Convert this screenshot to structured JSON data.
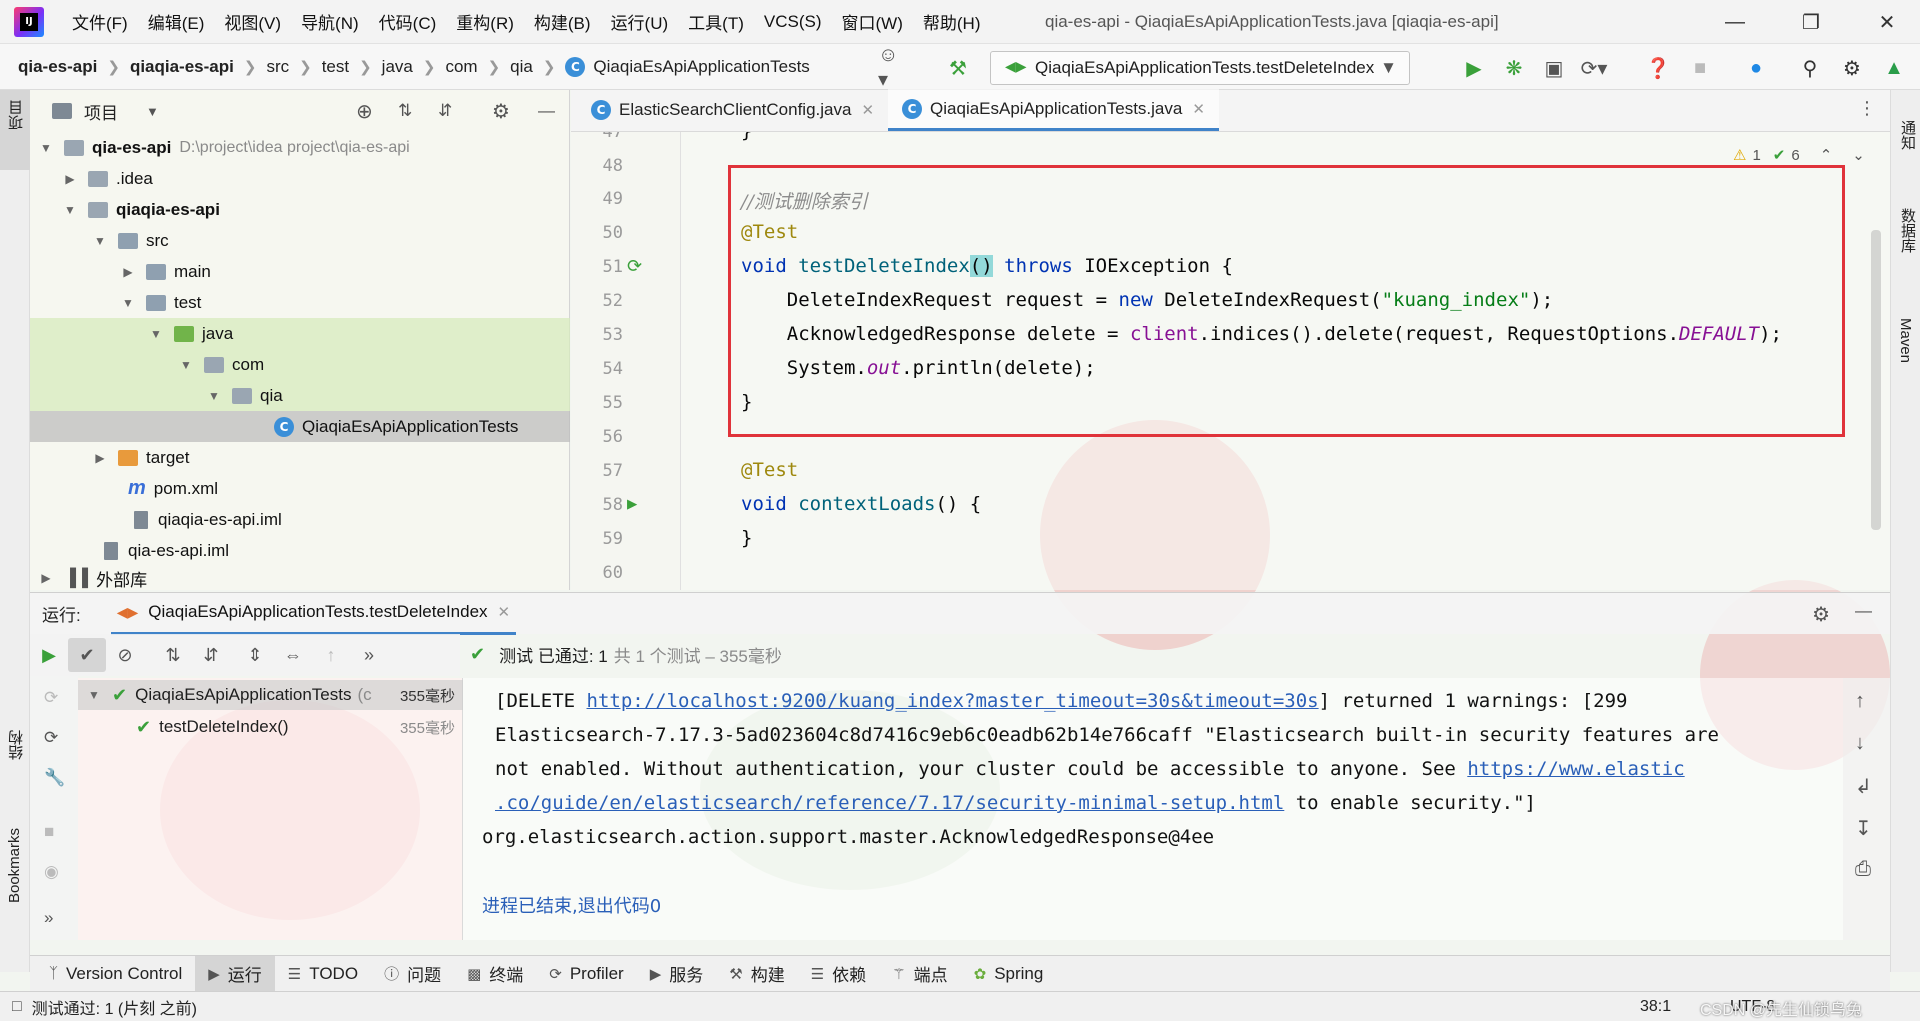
{
  "menu": {
    "items": [
      "文件(F)",
      "编辑(E)",
      "视图(V)",
      "导航(N)",
      "代码(C)",
      "重构(R)",
      "构建(B)",
      "运行(U)",
      "工具(T)",
      "VCS(S)",
      "窗口(W)",
      "帮助(H)"
    ],
    "window_title": "qia-es-api - QiaqiaEsApiApplicationTests.java [qiaqia-es-api]"
  },
  "breadcrumb": [
    "qia-es-api",
    "qiaqia-es-api",
    "src",
    "test",
    "java",
    "com",
    "qia",
    "QiaqiaEsApiApplicationTests"
  ],
  "run_config": "QiaqiaEsApiApplicationTests.testDeleteIndex",
  "left_strip": {
    "project": "项目",
    "structure": "结构",
    "bookmarks": "Bookmarks"
  },
  "right_strip": {
    "notifications": "通知",
    "database": "数据库",
    "maven": "Maven"
  },
  "project_panel": {
    "title": "项目",
    "tree": [
      {
        "label": "qia-es-api",
        "path": "D:\\project\\idea project\\qia-es-api"
      },
      {
        "label": ".idea"
      },
      {
        "label": "qiaqia-es-api"
      },
      {
        "label": "src"
      },
      {
        "label": "main"
      },
      {
        "label": "test"
      },
      {
        "label": "java"
      },
      {
        "label": "com"
      },
      {
        "label": "qia"
      },
      {
        "label": "QiaqiaEsApiApplicationTests"
      },
      {
        "label": "target"
      },
      {
        "label": "pom.xml"
      },
      {
        "label": "qiaqia-es-api.iml"
      },
      {
        "label": "qia-es-api.iml"
      },
      {
        "label": "外部库"
      }
    ]
  },
  "editor_tabs": [
    {
      "label": "ElasticSearchClientConfig.java"
    },
    {
      "label": "QiaqiaEsApiApplicationTests.java"
    }
  ],
  "editor": {
    "line_numbers": [
      "47",
      "48",
      "49",
      "50",
      "51",
      "52",
      "53",
      "54",
      "55",
      "56",
      "57",
      "58",
      "59",
      "60"
    ],
    "comment": "//测试删除索引",
    "annotation": "@Test",
    "method_name": "testDeleteIndex",
    "index_name": "\"kuang_index\"",
    "warnings": "1",
    "checks": "6"
  },
  "run_panel": {
    "label": "运行:",
    "tab": "QiaqiaEsApiApplicationTests.testDeleteIndex",
    "status": "测试 已通过: 1",
    "status_detail": "共 1 个测试 – 355毫秒",
    "tests": [
      {
        "name": "QiaqiaEsApiApplicationTests",
        "suffix": "(c",
        "duration": "355毫秒"
      },
      {
        "name": "testDeleteIndex()",
        "duration": "355毫秒"
      }
    ],
    "console": {
      "line1_prefix": "[DELETE ",
      "line1_link": "http://localhost:9200/kuang_index?master_timeout=30s&timeout=30s",
      "line1_suffix": "] returned 1 warnings: [299",
      "line2": "Elasticsearch-7.17.3-5ad023604c8d7416c9eb6c0eadb62b14e766caff \"Elasticsearch built-in security features are",
      "line3_prefix": "not enabled. Without authentication, your cluster could be accessible to anyone. See ",
      "line3_link": "https://www.elastic",
      "line4_link": ".co/guide/en/elasticsearch/reference/7.17/security-minimal-setup.html",
      "line4_suffix": " to enable security.\"]",
      "line5": "org.elasticsearch.action.support.master.AcknowledgedResponse@4ee",
      "exit": "进程已结束,退出代码0"
    }
  },
  "bottom_tabs": [
    "Version Control",
    "运行",
    "TODO",
    "问题",
    "终端",
    "Profiler",
    "服务",
    "构建",
    "依赖",
    "端点",
    "Spring"
  ],
  "status_bar": {
    "message": "测试通过: 1 (片刻 之前)",
    "position": "38:1",
    "encoding": "UTF-8",
    "watermark": "CSDN @先生仙锁鸟兔"
  }
}
